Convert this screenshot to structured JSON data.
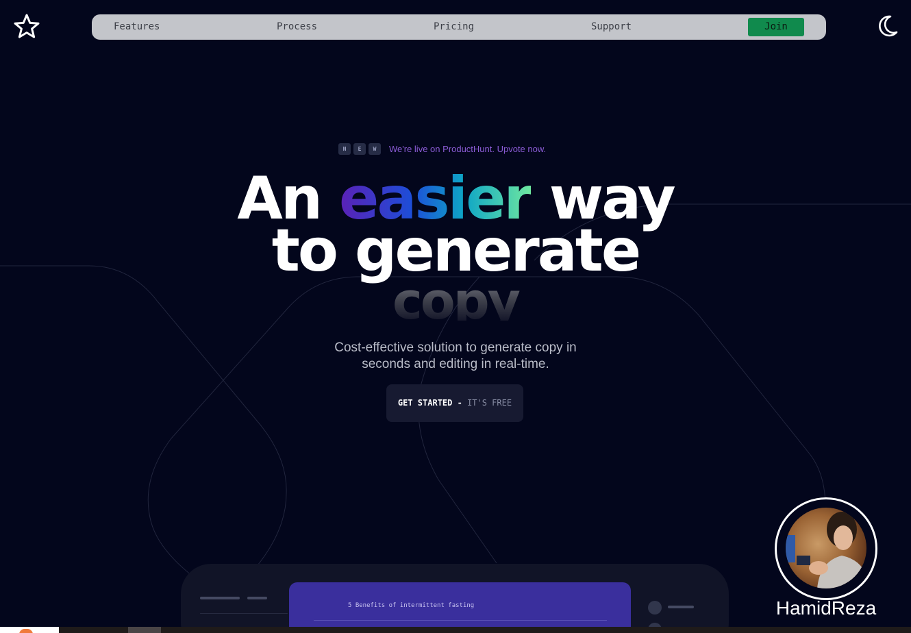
{
  "nav": {
    "links": [
      "Features",
      "Process",
      "Pricing",
      "Support"
    ],
    "join": "Join"
  },
  "announcement": {
    "keys": [
      "N",
      "E",
      "W"
    ],
    "text": "We're live on ProductHunt. Upvote now."
  },
  "hero": {
    "line1_before": "An",
    "line1_highlight": "easier",
    "line1_after": "way",
    "line2": "to generate",
    "line3": "copy",
    "subtitle_line1": "Cost-effective solution to generate copy in",
    "subtitle_line2": "seconds and editing in real-time.",
    "cta_main": "GET STARTED -",
    "cta_sub": "IT'S FREE"
  },
  "preview": {
    "doc_title": "5 Benefits of intermittent fasting"
  },
  "avatar": {
    "name": "HamidReza"
  },
  "colors": {
    "background": "#03061c",
    "nav_pill": "#c3c5ca",
    "join": "#108a4d",
    "announcement": "#8b5cd6",
    "doc_panel": "#3a2f9d"
  }
}
